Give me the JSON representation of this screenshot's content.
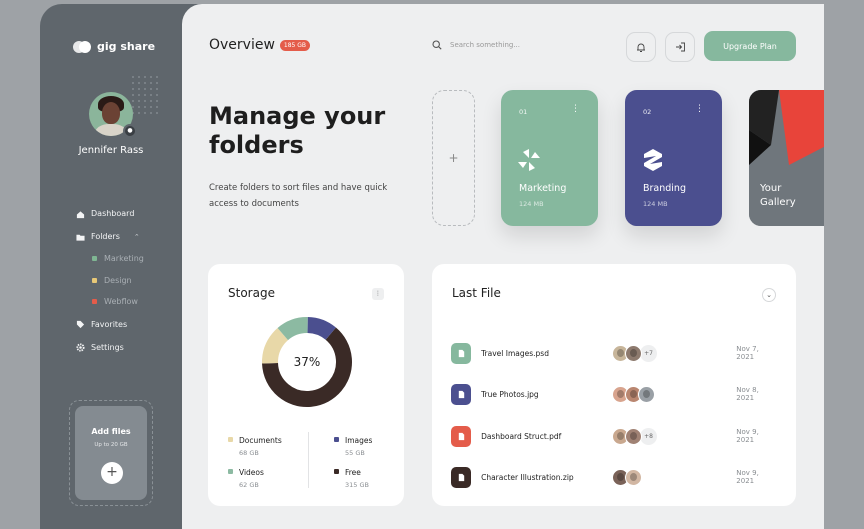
{
  "app": {
    "name": "gig share"
  },
  "user": {
    "name": "Jennifer Rass"
  },
  "nav": {
    "dashboard": "Dashboard",
    "folders": "Folders",
    "sub": [
      {
        "label": "Marketing",
        "color": "#7fb693"
      },
      {
        "label": "Design",
        "color": "#e8c877"
      },
      {
        "label": "Webflow",
        "color": "#e45c4a"
      }
    ],
    "favorites": "Favorites",
    "settings": "Settings"
  },
  "add_files": {
    "title": "Add files",
    "subtitle": "Up to 20 GB",
    "plus": "+"
  },
  "header": {
    "title": "Overview",
    "badge": "185 GB",
    "search_placeholder": "Search something...",
    "upgrade": "Upgrade Plan"
  },
  "hero": {
    "title_line1": "Manage your",
    "title_line2": "folders",
    "description": "Create folders to sort files and have quick access to documents"
  },
  "add_folder": "+",
  "folders": [
    {
      "num": "01",
      "name": "Marketing",
      "size": "124 MB",
      "color": "#86b89e"
    },
    {
      "num": "02",
      "name": "Branding",
      "size": "124 MB",
      "color": "#4b4f8f"
    }
  ],
  "gallery": {
    "line1": "Your",
    "line2": "Gallery"
  },
  "storage": {
    "title": "Storage",
    "percent": "37%",
    "legend": [
      {
        "label": "Documents",
        "size": "68 GB",
        "color": "#e8d8a8"
      },
      {
        "label": "Images",
        "size": "55 GB",
        "color": "#4b4f8f"
      },
      {
        "label": "Videos",
        "size": "62 GB",
        "color": "#8cbaa2"
      },
      {
        "label": "Free",
        "size": "315 GB",
        "color": "#3a2a26"
      }
    ]
  },
  "last_file": {
    "title": "Last File",
    "files": [
      {
        "name": "Travel Images.psd",
        "date": "Nov 7, 2021",
        "more": "+7",
        "icon_color": "#86b89e"
      },
      {
        "name": "True Photos.jpg",
        "date": "Nov 8, 2021",
        "more": "",
        "icon_color": "#4b4f8f"
      },
      {
        "name": "Dashboard Struct.pdf",
        "date": "Nov 9, 2021",
        "more": "+8",
        "icon_color": "#e45c4a"
      },
      {
        "name": "Character Illustration.zip",
        "date": "Nov 9, 2021",
        "more": "",
        "icon_color": "#3a2a26"
      }
    ]
  }
}
